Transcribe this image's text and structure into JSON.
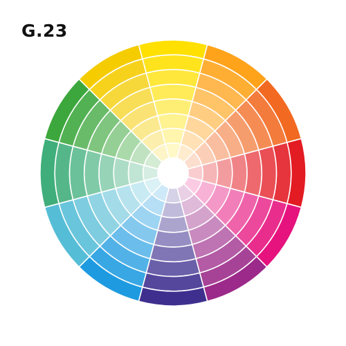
{
  "figure": {
    "label": "G.23"
  },
  "color_wheel": {
    "sector_count": 12,
    "ring_count": 8,
    "separator_color": "#ffffff",
    "center_color": "#ffffff",
    "hues": [
      {
        "name": "yellow",
        "color": "#FFE000"
      },
      {
        "name": "yellow-orange",
        "color": "#FFA31A"
      },
      {
        "name": "orange",
        "color": "#F26A21"
      },
      {
        "name": "red",
        "color": "#E31B23"
      },
      {
        "name": "magenta",
        "color": "#E6127E"
      },
      {
        "name": "red-violet",
        "color": "#9C2A8A"
      },
      {
        "name": "violet",
        "color": "#3E2F8F"
      },
      {
        "name": "blue",
        "color": "#1E9BE0"
      },
      {
        "name": "cyan",
        "color": "#56BDD6"
      },
      {
        "name": "teal-green",
        "color": "#3FAE7A"
      },
      {
        "name": "green",
        "color": "#3CA73C"
      },
      {
        "name": "yellow-green",
        "color": "#F5CC00"
      }
    ]
  }
}
